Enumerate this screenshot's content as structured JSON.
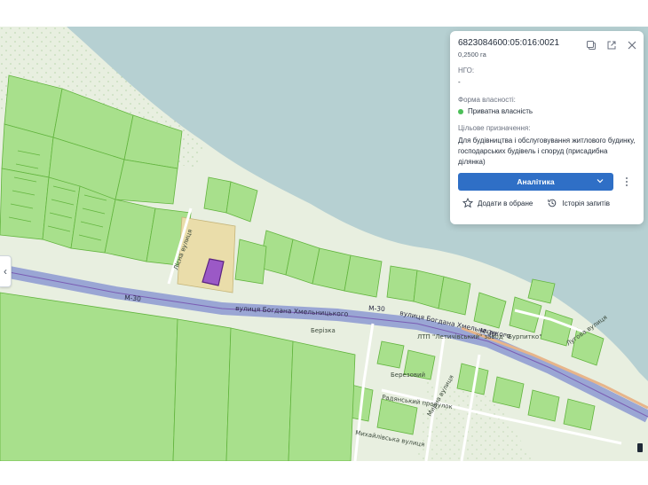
{
  "map": {
    "road_labels": {
      "m30_left": "M-30",
      "m30_mid": "M-30",
      "street_main": "вулиця Богдана Хмельницького",
      "street_right": "вулиця Богдана Хмельницького",
      "m30_right": "М-30"
    },
    "place_labels": {
      "berizka": "Берізка",
      "ltp": "ЛТП \"Летичівський\" завод \"Бурпитко\"",
      "bereznyi": "Березовий",
      "radianskyi": "Радянський провулок",
      "myrnyi": "Мирна вулиця",
      "khmelnytsky_lane": "Хмельницька вулиця",
      "mykhailivka": "Михайлівська вулиця",
      "vertical_left": "Лісна вулиця",
      "right_street": "Лугова вулиця"
    },
    "colors": {
      "water": "#b6d0d2",
      "land": "#e8efe0",
      "parcel_fill": "#a8e08c",
      "parcel_stroke": "#62b43e",
      "selected_parcel": "#9b59c6",
      "road_highway": "#9aa6d4",
      "road_local": "#ffffff",
      "industrial": "#eaddaa"
    }
  },
  "card": {
    "cadastral_number": "6823084600:05:016:0021",
    "area": "0,2500 га",
    "ngo_label": "НГО:",
    "ngo_value": "-",
    "ownership_label": "Форма власності:",
    "ownership_value": "Приватна власність",
    "ownership_color": "#4cbf58",
    "purpose_label": "Цільове призначення:",
    "purpose_value": "Для будівництва і обслуговування житлового будинку, господарських будівель і споруд (присадибна ділянка)",
    "analytics_button": "Аналітика",
    "add_favorite": "Додати в обране",
    "history": "Історія запитів",
    "accent_color": "#2f6fc6",
    "icons": [
      "copy-icon",
      "external-link-icon",
      "close-icon",
      "star-icon",
      "history-icon",
      "chevron-down-icon",
      "more-vertical-icon"
    ]
  }
}
